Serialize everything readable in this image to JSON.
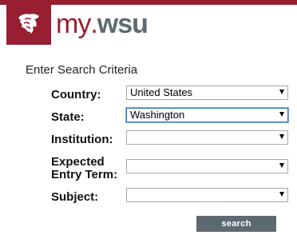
{
  "brand": {
    "my": "my",
    "dot": ".",
    "wsu": "wsu"
  },
  "title": "Enter Search Criteria",
  "fields": {
    "country": {
      "label": "Country:",
      "value": "United States"
    },
    "state": {
      "label": "State:",
      "value": "Washington"
    },
    "institution": {
      "label": "Institution:",
      "value": ""
    },
    "term": {
      "label_line1": "Expected",
      "label_line2": "Entry Term:",
      "value": ""
    },
    "subject": {
      "label": "Subject:",
      "value": ""
    }
  },
  "search_label": "search",
  "colors": {
    "crimson": "#981e32",
    "gray": "#5e6a71"
  }
}
